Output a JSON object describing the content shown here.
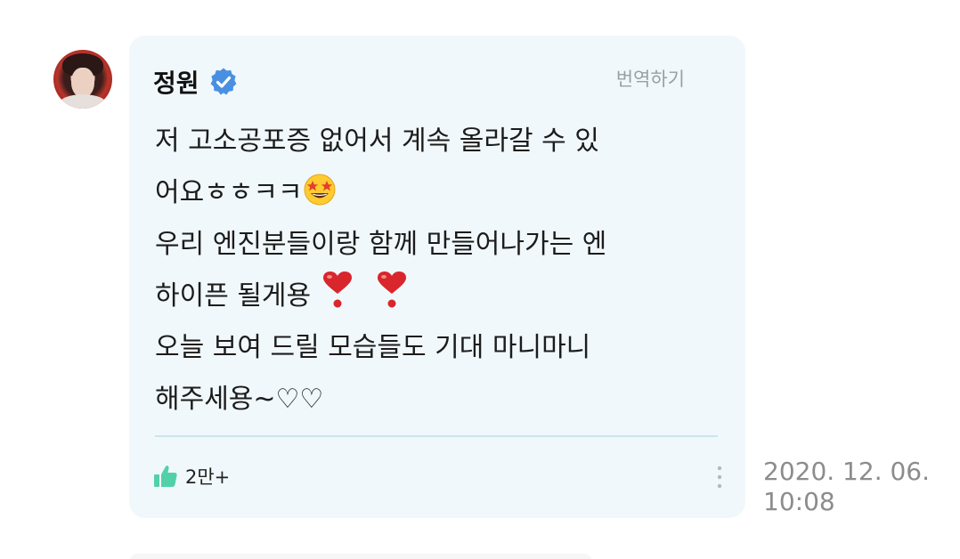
{
  "comment": {
    "author": "정원",
    "translate_label": "번역하기",
    "lines": [
      "저 고소공포증 없어서 계속 올라갈 수 있",
      "어요ㅎㅎㅋㅋ",
      "우리 엔진분들이랑 함께 만들어나가는 엔",
      "하이픈 될게용",
      "오늘 보여 드릴 모습들도 기대 마니마니",
      "해주세용~♡♡"
    ],
    "like_count": "2만+",
    "timestamp_date": "2020. 12. 06.",
    "timestamp_time": "10:08"
  },
  "colors": {
    "bubble_bg": "#f1f8fb",
    "verified_blue": "#4a90e2",
    "like_green": "#52d1a8",
    "divider": "#c9e6ec",
    "heart_red": "#d9252c"
  },
  "icons": {
    "verified": "verified-badge-icon",
    "star_struck": "star-struck-emoji",
    "exclamation": "heavy-heart-exclamation-emoji",
    "like": "thumbs-up-icon",
    "more": "more-vertical-icon"
  }
}
